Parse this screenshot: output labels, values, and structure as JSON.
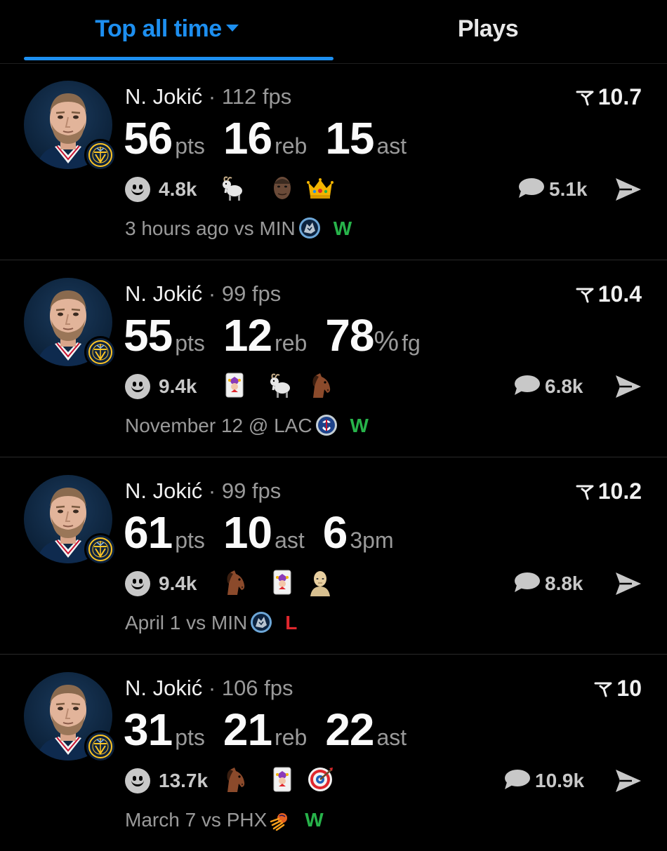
{
  "tabs": {
    "top_label": "Top all time",
    "plays_label": "Plays"
  },
  "colors": {
    "accent": "#1d8ff0",
    "win": "#27b34a",
    "loss": "#e0272d",
    "muted": "#9a9a9a"
  },
  "items": [
    {
      "player": "N. Jokić",
      "dot": "·",
      "fps": "112 fps",
      "rating": "10.7",
      "stats": [
        {
          "num": "56",
          "unit": "pts"
        },
        {
          "num": "16",
          "unit": "reb"
        },
        {
          "num": "15",
          "unit": "ast"
        }
      ],
      "reactions": "4.8k",
      "emojis": [
        "goat-emoji",
        "player-face-emoji",
        "crown-emoji"
      ],
      "comments": "5.1k",
      "date": "3 hours ago vs MIN",
      "opponent_icon": "timberwolves-logo",
      "result": "W"
    },
    {
      "player": "N. Jokić",
      "dot": "·",
      "fps": "99 fps",
      "rating": "10.4",
      "stats": [
        {
          "num": "55",
          "unit": "pts"
        },
        {
          "num": "12",
          "unit": "reb"
        },
        {
          "num": "78",
          "pct": "%",
          "unit": "fg"
        }
      ],
      "reactions": "9.4k",
      "emojis": [
        "joker-card-emoji",
        "goat-emoji",
        "horse-emoji"
      ],
      "comments": "6.8k",
      "date": "November 12 @ LAC",
      "opponent_icon": "clippers-logo",
      "result": "W"
    },
    {
      "player": "N. Jokić",
      "dot": "·",
      "fps": "99 fps",
      "rating": "10.2",
      "stats": [
        {
          "num": "61",
          "unit": "pts"
        },
        {
          "num": "10",
          "unit": "ast"
        },
        {
          "num": "6",
          "unit": "3pm"
        }
      ],
      "reactions": "9.4k",
      "emojis": [
        "horse-emoji",
        "joker-card-emoji",
        "bald-man-emoji"
      ],
      "comments": "8.8k",
      "date": "April 1 vs MIN",
      "opponent_icon": "timberwolves-logo",
      "result": "L"
    },
    {
      "player": "N. Jokić",
      "dot": "·",
      "fps": "106 fps",
      "rating": "10",
      "stats": [
        {
          "num": "31",
          "unit": "pts"
        },
        {
          "num": "21",
          "unit": "reb"
        },
        {
          "num": "22",
          "unit": "ast"
        }
      ],
      "reactions": "13.7k",
      "emojis": [
        "horse-emoji",
        "joker-card-emoji",
        "target-emoji"
      ],
      "comments": "10.9k",
      "date": "March 7 vs PHX",
      "opponent_icon": "suns-logo",
      "result": "W"
    }
  ]
}
